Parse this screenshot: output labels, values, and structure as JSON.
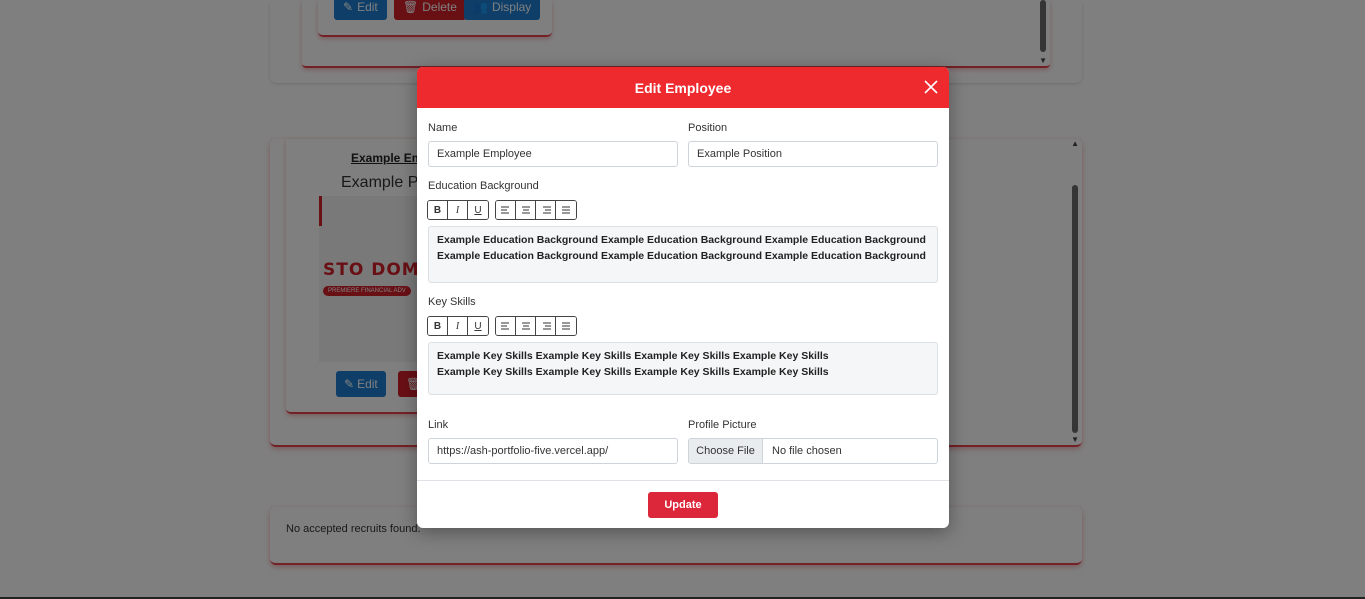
{
  "background": {
    "top_card": {
      "edit_label": "Edit",
      "delete_label": "Delete",
      "display_label": "Display"
    },
    "employee_card": {
      "name": "Example Em",
      "position": "Example Po",
      "image_brand_text": "STO DOMI",
      "image_tag_text": "PREMIERE FINANCIAL ADV",
      "edit_label": "Edit"
    },
    "recruits_message": "No accepted recruits found."
  },
  "modal": {
    "title": "Edit Employee",
    "name_label": "Name",
    "name_value": "Example Employee",
    "position_label": "Position",
    "position_value": "Example Position",
    "education_label": "Education Background",
    "education_text": "Example Education Background Example Education Background Example Education Background Example Education Background Example Education Background Example Education Background",
    "skills_label": "Key Skills",
    "skills_text": "Example Key Skills Example Key Skills Example Key Skills Example Key Skills Example Key Skills Example Key Skills Example Key Skills Example Key Skills",
    "link_label": "Link",
    "link_value": "https://ash-portfolio-five.vercel.app/",
    "picture_label": "Profile Picture",
    "choose_file_label": "Choose File",
    "file_status": "No file chosen",
    "update_label": "Update",
    "toolbar": {
      "bold": "B",
      "italic": "I",
      "underline": "U"
    }
  },
  "colors": {
    "header": "#ee2a2f",
    "update_button": "#dc2639",
    "edit_button": "#1e7fd3",
    "delete_button": "#d3202b"
  }
}
